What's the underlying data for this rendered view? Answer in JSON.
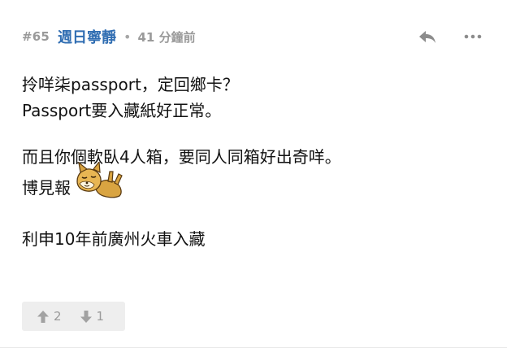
{
  "post": {
    "number": "#65",
    "username": "週日寧靜",
    "separator": "•",
    "time": "41 分鐘前"
  },
  "content": {
    "lines": [
      "拎咩柒passport，定回鄉卡？",
      "Passport要入藏紙好正常。",
      "而且你個軟臥4人箱，要同人同箱好出奇咩。",
      "博見報",
      "利申10年前廣州火車入藏"
    ]
  },
  "votes": {
    "up_count": "2",
    "down_count": "1"
  },
  "colors": {
    "username": "#2f6db2",
    "meta": "#9a9a9a",
    "vote_bg": "#eeeeee"
  },
  "icons": {
    "reply": "reply-icon",
    "more": "more-icon",
    "up": "thumb-up-arrow-icon",
    "down": "thumb-down-arrow-icon",
    "sticker": "dog-sticker-icon"
  }
}
